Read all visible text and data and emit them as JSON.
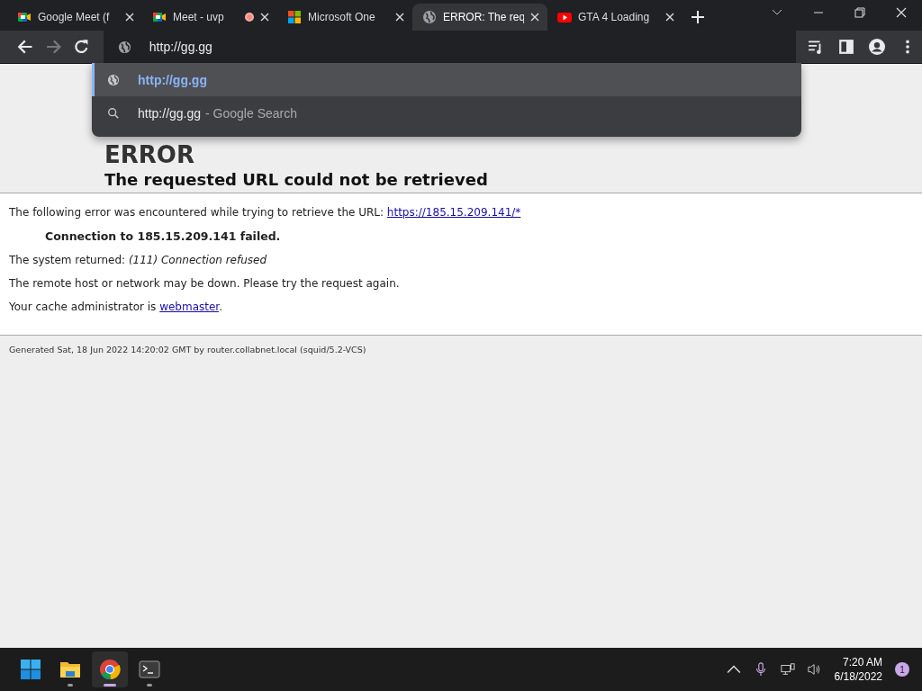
{
  "tabs": [
    {
      "kind": "meet",
      "title": "Google Meet (f",
      "recording": false,
      "selected": false
    },
    {
      "kind": "meet",
      "title": "Meet - uvp",
      "recording": true,
      "selected": false
    },
    {
      "kind": "tiles",
      "title": "Microsoft One",
      "recording": false,
      "selected": false
    },
    {
      "kind": "web",
      "title": "ERROR: The req",
      "recording": false,
      "selected": true
    },
    {
      "kind": "video",
      "title": "GTA 4 Loading",
      "recording": false,
      "selected": false
    }
  ],
  "omnibox": {
    "value": "http://gg.gg"
  },
  "suggestions": [
    {
      "kind": "url",
      "text": "http://gg.gg",
      "selected": true
    },
    {
      "kind": "search",
      "text": "http://gg.gg",
      "suffix": "- Google Search",
      "selected": false
    }
  ],
  "page": {
    "title": "ERROR",
    "heading": "The requested URL could not be retrieved",
    "intro": "The following error was encountered while trying to retrieve the URL:",
    "intro_link": "https://185.15.209.141/*",
    "failure": "Connection to 185.15.209.141 failed.",
    "returned": "The system returned:",
    "returned_detail": "(111) Connection refused",
    "advice": "The remote host or network may be down. Please try the request again.",
    "admin": "Your cache administrator is",
    "admin_link": "webmaster",
    "admin_end": ".",
    "footer": "Generated Sat, 18 Jun 2022 14:20:02 GMT by router.collabnet.local (squid/5.2-VCS)"
  },
  "taskbar": {
    "apps": [
      {
        "kind": "start",
        "running": false,
        "active": false
      },
      {
        "kind": "folder",
        "running": true,
        "active": false
      },
      {
        "kind": "chrome",
        "running": true,
        "active": true
      },
      {
        "kind": "terminal",
        "running": true,
        "active": false
      }
    ],
    "time": "7:20 AM",
    "date": "6/18/2022",
    "notifications": "1"
  }
}
